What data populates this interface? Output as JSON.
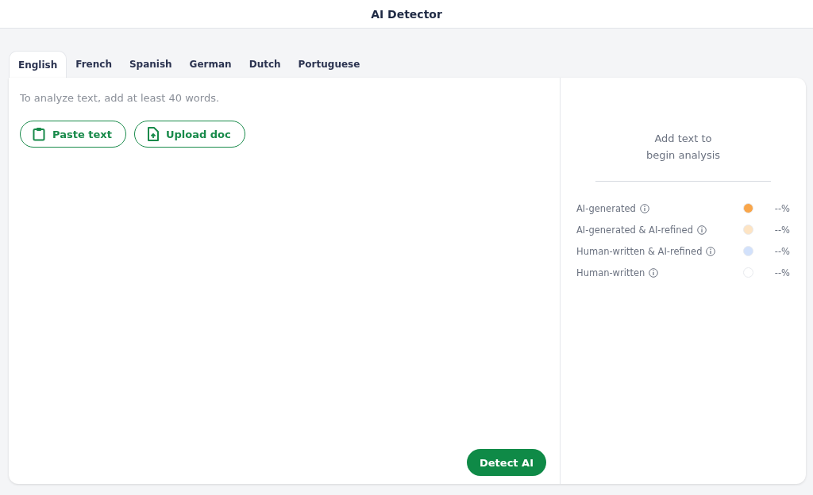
{
  "header": {
    "title": "AI Detector"
  },
  "tabs": [
    {
      "label": "English",
      "selected": true
    },
    {
      "label": "French",
      "selected": false
    },
    {
      "label": "Spanish",
      "selected": false
    },
    {
      "label": "German",
      "selected": false
    },
    {
      "label": "Dutch",
      "selected": false
    },
    {
      "label": "Portuguese",
      "selected": false
    }
  ],
  "editor": {
    "placeholder": "To analyze text, add at least 40 words.",
    "buttons": [
      {
        "label": "Paste text",
        "kind": "paste"
      },
      {
        "label": "Upload doc",
        "kind": "upload"
      }
    ],
    "submit": "Detect AI"
  },
  "results": {
    "message": "Add text to\nbegin analysis",
    "legend": [
      {
        "label": "AI-generated",
        "color": "#f9a64a",
        "value": "--%"
      },
      {
        "label": "AI-generated & AI-refined",
        "color": "#fde4c4",
        "value": "--%"
      },
      {
        "label": "Human-written & AI-refined",
        "color": "#d2e1fb",
        "value": "--%"
      },
      {
        "label": "Human-written",
        "color": "#ffffff",
        "value": "--%"
      }
    ]
  }
}
